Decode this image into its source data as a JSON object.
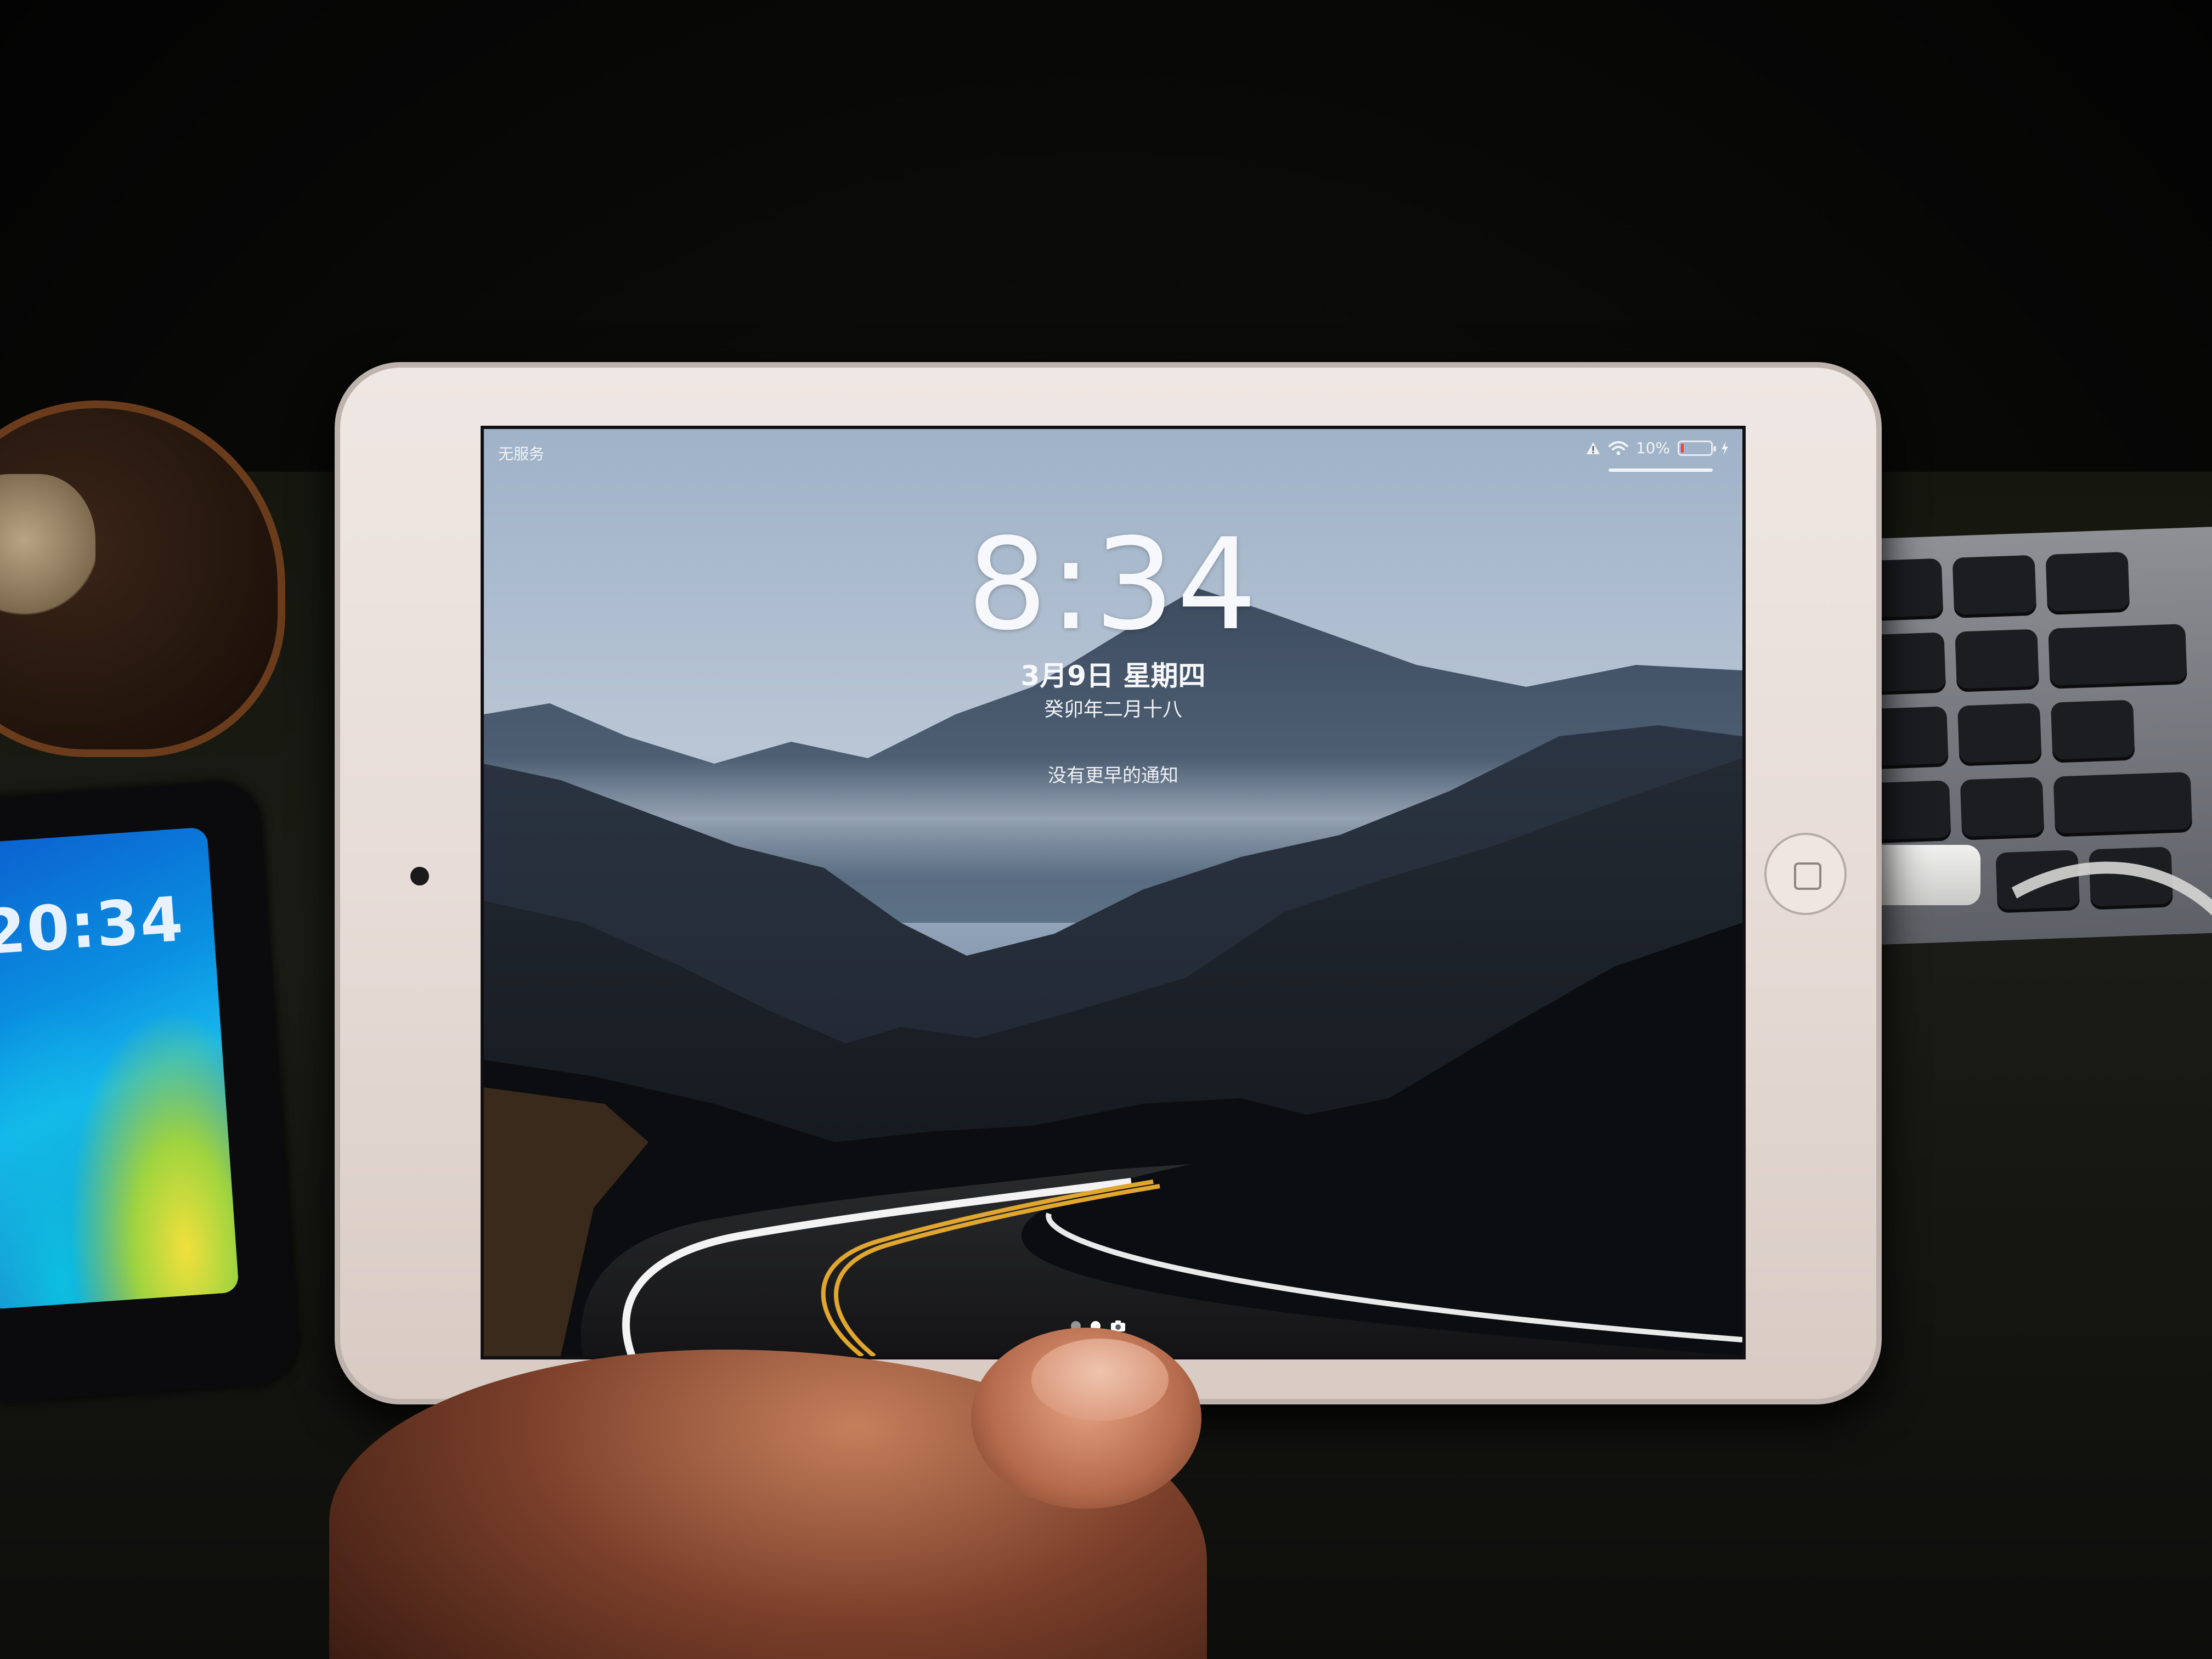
{
  "status_bar": {
    "carrier": "无服务",
    "battery_text": "10%",
    "battery_level_percent": 10,
    "icons": [
      "alert-triangle-icon",
      "wifi-icon",
      "battery-icon",
      "charging-bolt-icon"
    ]
  },
  "lock_screen": {
    "time": "8:34",
    "date": "3月9日 星期四",
    "lunar_date": "癸卯年二月十八",
    "notification_text": "没有更早的通知"
  },
  "page_indicator": {
    "pages": 2,
    "active_index": 1,
    "trailing_icon": "camera-icon"
  },
  "phone_lock_screen": {
    "time": "20:34"
  },
  "colors": {
    "battery_low": "#ff3b30",
    "text_white": "#f7f8fb"
  }
}
